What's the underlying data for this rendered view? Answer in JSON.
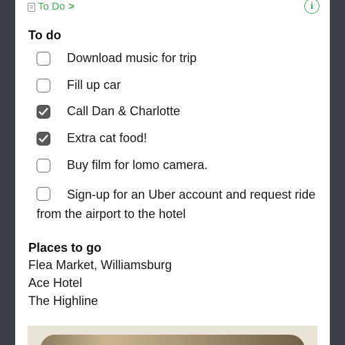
{
  "breadcrumb": {
    "label": "To Do",
    "chevron": ">"
  },
  "info_glyph": "i",
  "todo": {
    "title": "To do",
    "items": [
      {
        "label": "Download music for trip",
        "checked": false
      },
      {
        "label": "Fill up car",
        "checked": false
      },
      {
        "label": "Call Dan & Charlotte",
        "checked": true
      },
      {
        "label": "Extra cat food!",
        "checked": true
      },
      {
        "label": "Buy film for lomo camera.",
        "checked": false
      },
      {
        "label": "Sign-up for an Uber account and request ride from the airport to the hotel",
        "checked": false
      }
    ]
  },
  "places": {
    "title": "Places to go",
    "items": [
      "Flea Market, Williamsburg",
      "Ace Hotel",
      "The Highline"
    ]
  },
  "colors": {
    "accent": "#3fae5a",
    "background": "#3a3f4a",
    "checked_box": "#5a5a5a"
  }
}
